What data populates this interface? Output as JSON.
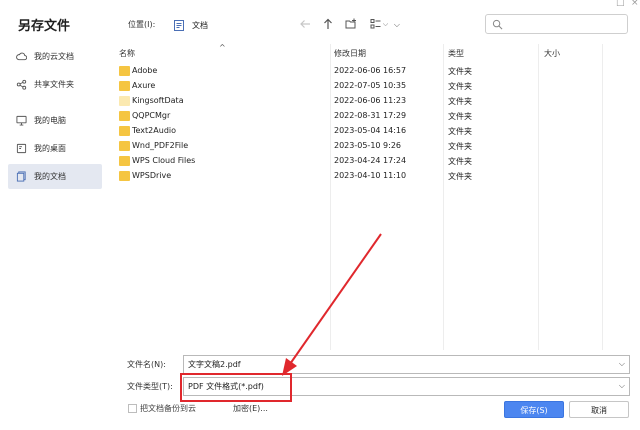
{
  "window": {
    "title": "另存文件",
    "min_glyph": "□",
    "close_glyph": "×"
  },
  "sidebar": {
    "items": [
      {
        "label": "我的云文档",
        "icon": "cloud-icon",
        "active": false
      },
      {
        "label": "共享文件夹",
        "icon": "share-icon",
        "active": false
      },
      {
        "label": "我的电脑",
        "icon": "monitor-icon",
        "active": false
      },
      {
        "label": "我的桌面",
        "icon": "desktop-icon",
        "active": false
      },
      {
        "label": "我的文档",
        "icon": "documents-icon",
        "active": true
      }
    ]
  },
  "toolbar": {
    "location_label": "位置(I):",
    "path": "文档",
    "search_placeholder": ""
  },
  "table": {
    "headers": {
      "name": "名称",
      "modified": "修改日期",
      "type": "类型",
      "size": "大小"
    },
    "rows": [
      {
        "name": "Adobe",
        "modified": "2022-06-06 16:57",
        "type": "文件夹",
        "size": "",
        "icon_color": "#f5c542"
      },
      {
        "name": "Axure",
        "modified": "2022-07-05 10:35",
        "type": "文件夹",
        "size": "",
        "icon_color": "#f5c542"
      },
      {
        "name": "KingsoftData",
        "modified": "2022-06-06 11:23",
        "type": "文件夹",
        "size": "",
        "icon_color": "#fbe9b0"
      },
      {
        "name": "QQPCMgr",
        "modified": "2022-08-31 17:29",
        "type": "文件夹",
        "size": "",
        "icon_color": "#f5c542"
      },
      {
        "name": "Text2Audio",
        "modified": "2023-05-04 14:16",
        "type": "文件夹",
        "size": "",
        "icon_color": "#f5c542"
      },
      {
        "name": "Wnd_PDF2File",
        "modified": "2023-05-10 9:26",
        "type": "文件夹",
        "size": "",
        "icon_color": "#f5c542"
      },
      {
        "name": "WPS Cloud Files",
        "modified": "2023-04-24 17:24",
        "type": "文件夹",
        "size": "",
        "icon_color": "#f5c542"
      },
      {
        "name": "WPSDrive",
        "modified": "2023-04-10 11:10",
        "type": "文件夹",
        "size": "",
        "icon_color": "#f5c542"
      }
    ]
  },
  "filename": {
    "label": "文件名(N):",
    "value": "文字文稿2.pdf"
  },
  "filetype": {
    "label": "文件类型(T):",
    "value": "PDF 文件格式(*.pdf)"
  },
  "backup": {
    "label": "把文档备份到云",
    "checked": false
  },
  "encrypt_label": "加密(E)...",
  "buttons": {
    "save": "保存(S)",
    "cancel": "取消"
  },
  "colors": {
    "accent": "#4c86f0",
    "annotation": "#e0282d",
    "folder": "#f5c542",
    "active_sidebar": "#e4e8f1"
  }
}
